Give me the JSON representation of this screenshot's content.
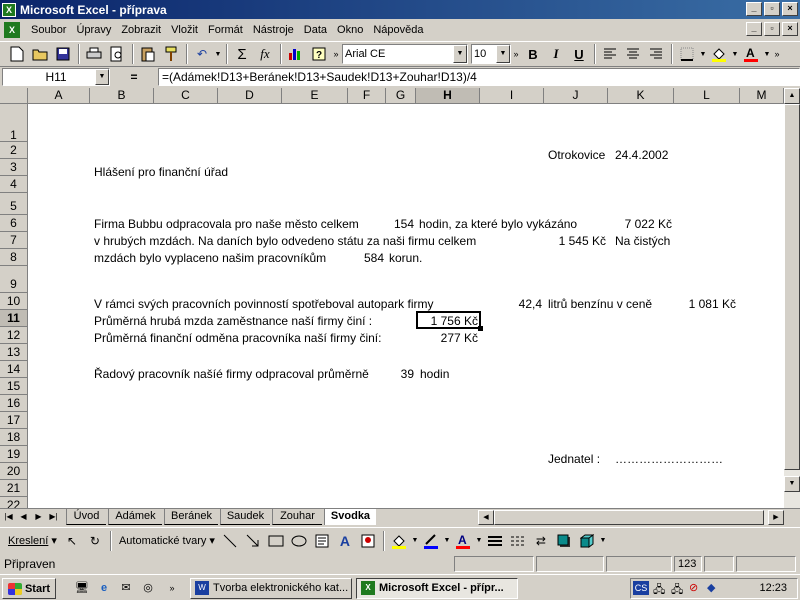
{
  "window": {
    "title": "Microsoft Excel - příprava",
    "app_icon": "excel-icon"
  },
  "menu": [
    "Soubor",
    "Úpravy",
    "Zobrazit",
    "Vložit",
    "Formát",
    "Nástroje",
    "Data",
    "Okno",
    "Nápověda"
  ],
  "toolbar": {
    "font_name": "Arial CE",
    "font_size": "10",
    "sum": "Σ",
    "fx": "fx",
    "bold": "B",
    "italic": "I",
    "underline": "U"
  },
  "formula_bar": {
    "name_box": "H11",
    "equals": "=",
    "formula": "=(Adámek!D13+Beránek!D13+Saudek!D13+Zouhar!D13)/4"
  },
  "columns": [
    "A",
    "B",
    "C",
    "D",
    "E",
    "F",
    "G",
    "H",
    "I",
    "J",
    "K",
    "L",
    "M"
  ],
  "active_column": "H",
  "rows": [
    "1",
    "2",
    "3",
    "4",
    "5",
    "6",
    "7",
    "8",
    "9",
    "10",
    "11",
    "12",
    "13",
    "14",
    "15",
    "16",
    "17",
    "18",
    "19",
    "20",
    "21",
    "22"
  ],
  "active_row": "11",
  "cells": {
    "date_place": "Otrokovice",
    "date": "24.4.2002",
    "title": "Hlášení pro finanční úřad",
    "r6_text": "Firma Bubbu odpracovala pro naše město celkem",
    "r6_hours": "154",
    "r6_text2": "hodin, za které bylo vykázáno",
    "r6_amount": "7 022 Kč",
    "r7_text": "v hrubých mzdách. Na daních bylo odvedeno státu za naši firmu celkem",
    "r7_amount": "1 545 Kč",
    "r7_text2": "Na čistých",
    "r8_text": "mzdách bylo vyplaceno našim pracovníkům",
    "r8_amount": "584",
    "r8_text2": "korun.",
    "r10_text": "V rámci svých pracovních povinností spotřeboval autopark firmy",
    "r10_liters": "42,4",
    "r10_text2": "litrů benzínu v ceně",
    "r10_price": "1 081 Kč",
    "r11_text": "Průměrná hrubá mzda zaměstnance naší firmy  činí :",
    "r11_value": "1 756 Kč",
    "r12_text": "Průměrná finanční odměna pracovníka naší firmy činí:",
    "r12_value": "277 Kč",
    "r14_text": "Řadový pracovník našíé firmy odpracoval průměrně",
    "r14_hours": "39",
    "r14_text2": "hodin",
    "r19_label": "Jednatel :",
    "r19_dots": "………………………"
  },
  "sheets": [
    "Úvod",
    "Adámek",
    "Beránek",
    "Saudek",
    "Zouhar",
    "Svodka"
  ],
  "active_sheet": "Svodka",
  "draw_toolbar": {
    "draw_label": "Kreslení",
    "autoshapes_label": "Automatické tvary"
  },
  "status": {
    "text": "Připraven",
    "indicator": "123"
  },
  "taskbar": {
    "start": "Start",
    "tasks": [
      "Tvorba elektronického kat...",
      "Microsoft Excel - přípr..."
    ],
    "tray_lang": "CS",
    "clock": "12:23"
  }
}
